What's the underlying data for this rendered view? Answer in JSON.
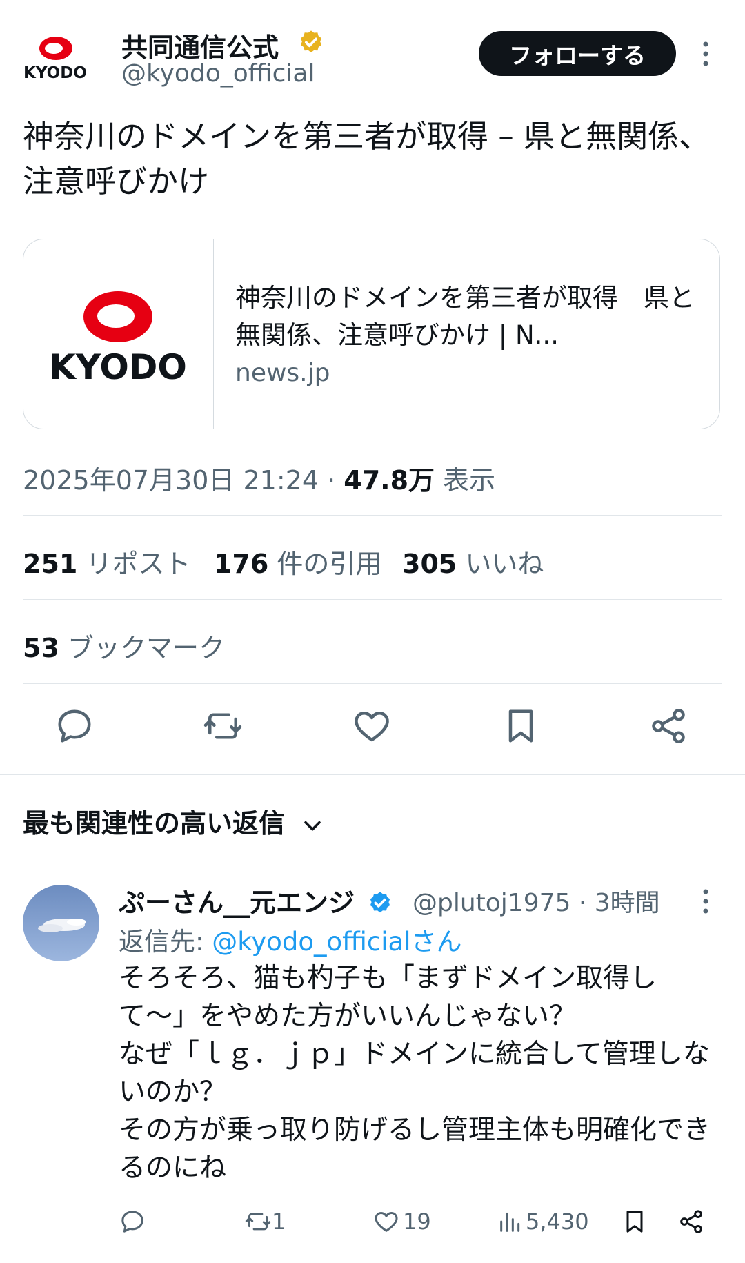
{
  "header": {
    "logo_text": "KYODO",
    "name": "共同通信公式",
    "handle": "@kyodo_official",
    "follow_label": "フォローする"
  },
  "tweet": {
    "text": "神奈川のドメインを第三者が取得 – 県と無関係、注意呼びかけ",
    "card": {
      "logo_text": "KYODO",
      "title": "神奈川のドメインを第三者が取得　県と無関係、注意呼びかけ | N...",
      "domain": "news.jp"
    },
    "timestamp": "2025年07月30日 21:24",
    "sep": "·",
    "views_count": "47.8万",
    "views_label": "表示"
  },
  "stats": {
    "reposts": {
      "count": "251",
      "label": "リポスト"
    },
    "quotes": {
      "count": "176",
      "label": "件の引用"
    },
    "likes": {
      "count": "305",
      "label": "いいね"
    },
    "bookmarks": {
      "count": "53",
      "label": "ブックマーク"
    }
  },
  "replies_section": {
    "title": "最も関連性の高い返信"
  },
  "reply": {
    "name": "ぷーさん__元エンジ",
    "handle_time": "@plutoj1975 · 3時間",
    "reply_to_prefix": "返信先: ",
    "reply_to_handle": "@kyodo_officialさん",
    "text": "そろそろ、猫も杓子も「まずドメイン取得して〜」をやめた方がいいんじゃない？\nなぜ「ｌｇ．ｊｐ」ドメインに統合して管理しないのか？\nその方が乗っ取り防げるし管理主体も明確化できるのにね",
    "retweets": "1",
    "likes": "19",
    "views": "5,430"
  },
  "colors": {
    "accent_blue": "#1d9bf0",
    "gold_badge": "#e8b21e",
    "kyodo_red": "#e60012",
    "text_primary": "#0f1419",
    "text_secondary": "#536471"
  }
}
